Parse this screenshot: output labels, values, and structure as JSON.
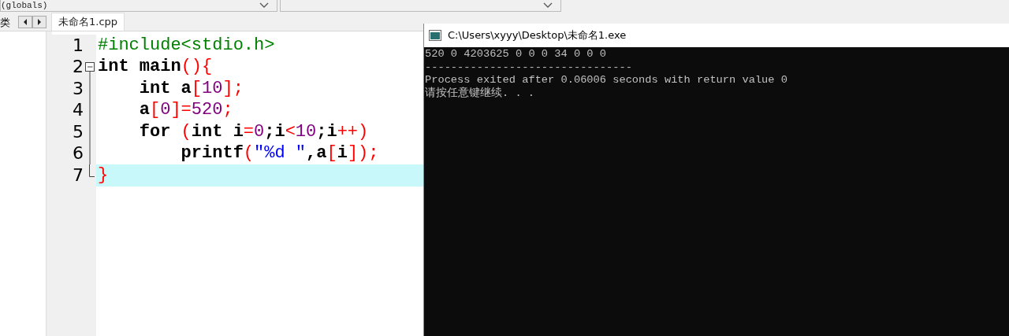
{
  "toolbar": {
    "scope_combo": "(globals)"
  },
  "side_tab": "类",
  "file_tabs": [
    {
      "label": "未命名1.cpp",
      "selected": true
    }
  ],
  "editor": {
    "lines": [
      {
        "kind": "plain",
        "number": "1",
        "highlighted": false,
        "tokens": [
          {
            "kind": "pre",
            "text": "#include<stdio.h>"
          }
        ]
      },
      {
        "kind": "foldstart",
        "number": "2",
        "highlighted": false,
        "tokens": [
          {
            "kind": "kw",
            "text": "int"
          },
          {
            "kind": "id",
            "text": " main"
          },
          {
            "kind": "sym",
            "text": "(){"
          }
        ]
      },
      {
        "kind": "folded",
        "number": "3",
        "highlighted": false,
        "tokens": [
          {
            "kind": "kw",
            "text": "    int"
          },
          {
            "kind": "id",
            "text": " a"
          },
          {
            "kind": "sym",
            "text": "["
          },
          {
            "kind": "num",
            "text": "10"
          },
          {
            "kind": "sym",
            "text": "];"
          }
        ]
      },
      {
        "kind": "folded",
        "number": "4",
        "highlighted": false,
        "tokens": [
          {
            "kind": "id",
            "text": "    a"
          },
          {
            "kind": "sym",
            "text": "["
          },
          {
            "kind": "num",
            "text": "0"
          },
          {
            "kind": "sym",
            "text": "]="
          },
          {
            "kind": "num",
            "text": "520"
          },
          {
            "kind": "sym",
            "text": ";"
          }
        ]
      },
      {
        "kind": "folded",
        "number": "5",
        "highlighted": false,
        "tokens": [
          {
            "kind": "kw",
            "text": "    for"
          },
          {
            "kind": "sym",
            "text": " ("
          },
          {
            "kind": "kw",
            "text": "int"
          },
          {
            "kind": "id",
            "text": " i"
          },
          {
            "kind": "sym",
            "text": "="
          },
          {
            "kind": "num",
            "text": "0"
          },
          {
            "kind": "id",
            "text": ";i"
          },
          {
            "kind": "sym",
            "text": "<"
          },
          {
            "kind": "num",
            "text": "10"
          },
          {
            "kind": "id",
            "text": ";i"
          },
          {
            "kind": "sym",
            "text": "++)"
          }
        ]
      },
      {
        "kind": "folded",
        "number": "6",
        "highlighted": false,
        "tokens": [
          {
            "kind": "id",
            "text": "        printf"
          },
          {
            "kind": "sym",
            "text": "("
          },
          {
            "kind": "str",
            "text": "\"%d \""
          },
          {
            "kind": "id",
            "text": ",a"
          },
          {
            "kind": "sym",
            "text": "["
          },
          {
            "kind": "id",
            "text": "i"
          },
          {
            "kind": "sym",
            "text": "]);"
          }
        ]
      },
      {
        "kind": "foldend",
        "number": "7",
        "highlighted": true,
        "tokens": [
          {
            "kind": "sym",
            "text": "}"
          }
        ]
      }
    ]
  },
  "console": {
    "title": "C:\\Users\\xyyy\\Desktop\\未命名1.exe",
    "lines": [
      "520 0 4203625 0 0 0 34 0 0 0",
      "--------------------------------",
      "Process exited after 0.06006 seconds with return value 0",
      "请按任意键继续. . ."
    ]
  }
}
